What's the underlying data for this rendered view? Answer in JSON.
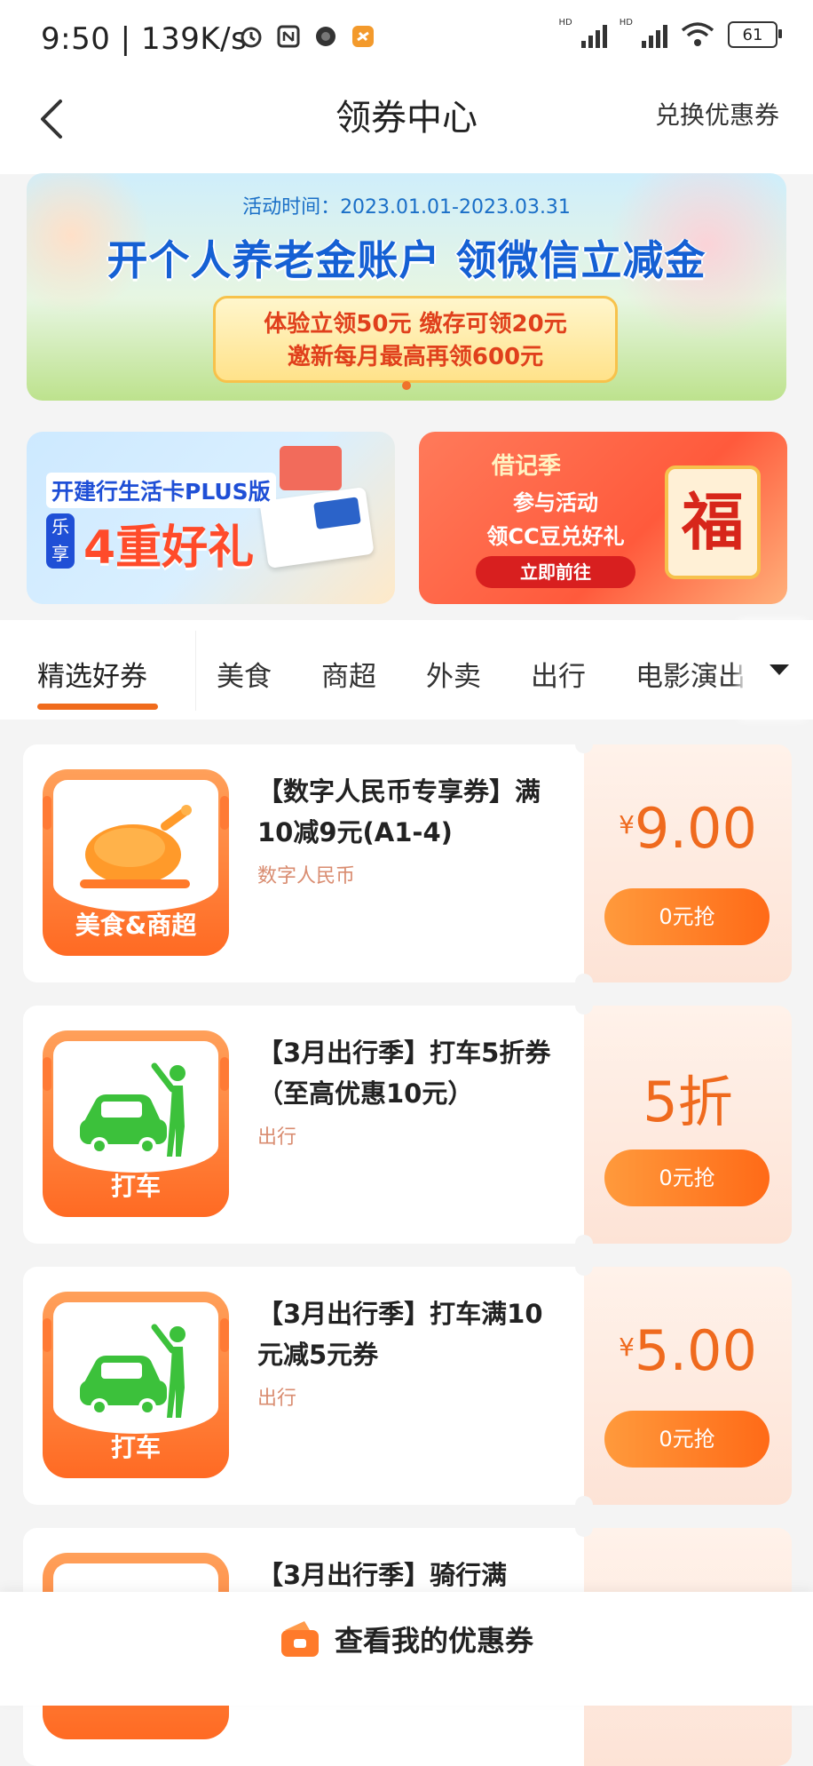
{
  "status_bar": {
    "time": "9:50",
    "speed": "139K/s",
    "battery": "61",
    "hd1": "HD",
    "hd2": "HD"
  },
  "header": {
    "title": "领券中心",
    "exchange_label": "兑换优惠券"
  },
  "banners": {
    "main": {
      "time": "活动时间：2023.01.01-2023.03.31",
      "headline": "开个人养老金账户  领微信立减金",
      "line1": "体验立领50元 缴存可领20元",
      "line2": "邀新每月最高再领600元"
    },
    "left": {
      "line1": "开建行生活卡PLUS版",
      "badge": "乐享",
      "line2": "4重好礼"
    },
    "right": {
      "top": "借记季",
      "line1": "参与活动",
      "line2": "领CC豆兑好礼",
      "button": "立即前往",
      "fu": "福"
    }
  },
  "tabs": [
    "精选好券",
    "美食",
    "商超",
    "外卖",
    "出行",
    "电影演出"
  ],
  "coupons": [
    {
      "title": "【数字人民币专享券】满10减9元(A1-4)",
      "category": "数字人民币",
      "icon_label": "美食&商超",
      "icon": "chicken-icon",
      "currency": "¥",
      "amount": "9.00",
      "button": "0元抢"
    },
    {
      "title": "【3月出行季】打车5折券（至高优惠10元）",
      "category": "出行",
      "icon_label": "打车",
      "icon": "taxi-icon",
      "currency": "",
      "amount": "5折",
      "button": "0元抢"
    },
    {
      "title": "【3月出行季】打车满10元减5元券",
      "category": "出行",
      "icon_label": "打车",
      "icon": "taxi-icon",
      "currency": "¥",
      "amount": "5.00",
      "button": "0元抢"
    },
    {
      "title": "【3月出行季】骑行满",
      "category": "",
      "icon_label": "",
      "icon": "bike-icon",
      "currency": "",
      "amount": "",
      "button": ""
    }
  ],
  "bottom": {
    "label": "查看我的优惠券"
  },
  "colors": {
    "accent": "#f06b1c",
    "price": "#ef6a1e",
    "category": "#d98c70",
    "icon_green": "#3cc13b"
  }
}
